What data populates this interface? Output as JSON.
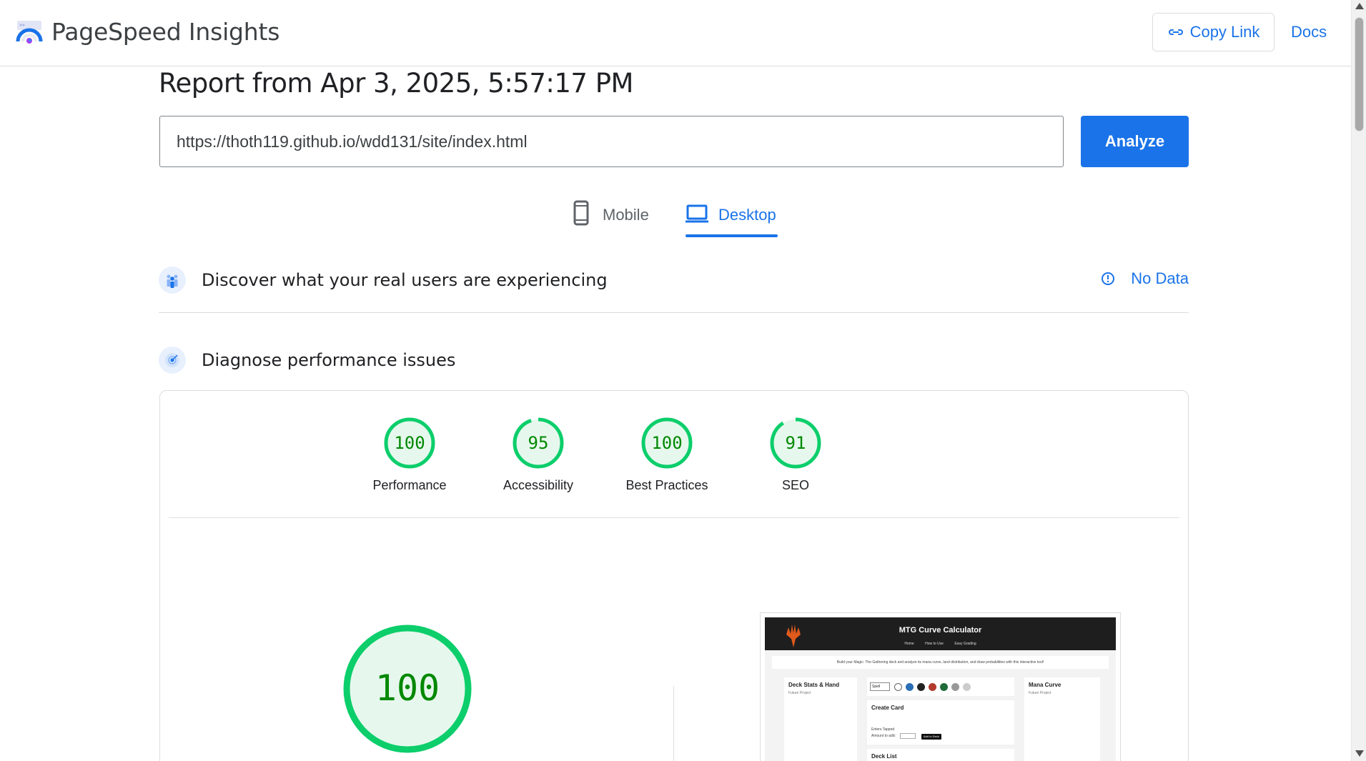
{
  "header": {
    "brand": "PageSpeed Insights",
    "copy_link": "Copy Link",
    "docs": "Docs"
  },
  "report": {
    "title": "Report from Apr 3, 2025, 5:57:17 PM"
  },
  "url_bar": {
    "value": "https://thoth119.github.io/wdd131/site/index.html",
    "analyze": "Analyze"
  },
  "tabs": {
    "mobile": "Mobile",
    "desktop": "Desktop",
    "active": "desktop"
  },
  "sections": {
    "field_data": {
      "title": "Discover what your real users are experiencing",
      "status": "No Data"
    },
    "lab_data": {
      "title": "Diagnose performance issues"
    }
  },
  "scores": [
    {
      "label": "Performance",
      "value": "100",
      "fraction": 1.0
    },
    {
      "label": "Accessibility",
      "value": "95",
      "fraction": 0.95
    },
    {
      "label": "Best Practices",
      "value": "100",
      "fraction": 1.0
    },
    {
      "label": "SEO",
      "value": "91",
      "fraction": 0.91
    }
  ],
  "main_score": {
    "value": "100",
    "fraction": 1.0
  },
  "colors": {
    "accent": "#1a73e8",
    "pass": "#0cce6b",
    "pass_text": "#008800",
    "pass_fill": "#e6f8ed"
  },
  "screenshot": {
    "site_title": "MTG Curve Calculator",
    "nav": [
      "Home",
      "How to Use",
      "Easy Grading"
    ],
    "intro": "Build your Magic: The Gathering deck and analyze its mana curve, land distribution, and draw probabilities with this interactive tool!",
    "deck_stats_title": "Deck Stats & Hand",
    "deck_stats_sub": "Future Project",
    "spell_select": "Spell",
    "create_card_title": "Create Card",
    "enters_tapped": "Enters Tapped",
    "amount_label": "Amount to add:",
    "amount_value": "1",
    "add_button": "Add to Deck",
    "deck_list_title": "Deck List",
    "mana_curve_title": "Mana Curve",
    "mana_curve_sub": "Future Project"
  }
}
